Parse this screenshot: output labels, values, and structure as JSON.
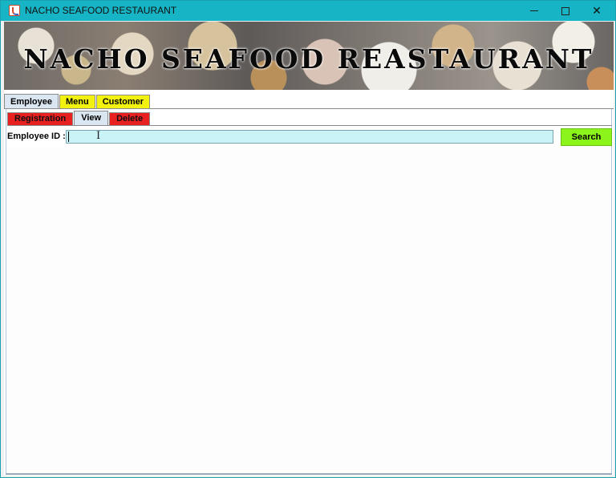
{
  "window": {
    "title": "NACHO SEAFOOD RESTAURANT",
    "controls": {
      "minimize": "minimize-icon",
      "maximize": "maximize-icon",
      "close": "close-icon",
      "close_glyph": "✕"
    }
  },
  "banner": {
    "text": "NACHO SEAFOOD REASTAURANT"
  },
  "tabs": [
    {
      "label": "Employee",
      "active": true,
      "color": "#dbe6f3"
    },
    {
      "label": "Menu",
      "active": false,
      "color": "#f2f20e"
    },
    {
      "label": "Customer",
      "active": false,
      "color": "#f2f20e"
    }
  ],
  "subtabs": [
    {
      "label": "Registration",
      "active": false,
      "color": "#e82020"
    },
    {
      "label": "View",
      "active": true,
      "color": "#dbe6f3"
    },
    {
      "label": "Delete",
      "active": false,
      "color": "#e82020"
    }
  ],
  "form": {
    "employee_id_label": "Employee ID :",
    "employee_id_value": "",
    "input_color": "#c9f3f7",
    "search_label": "Search",
    "search_color": "#8bf41a"
  }
}
